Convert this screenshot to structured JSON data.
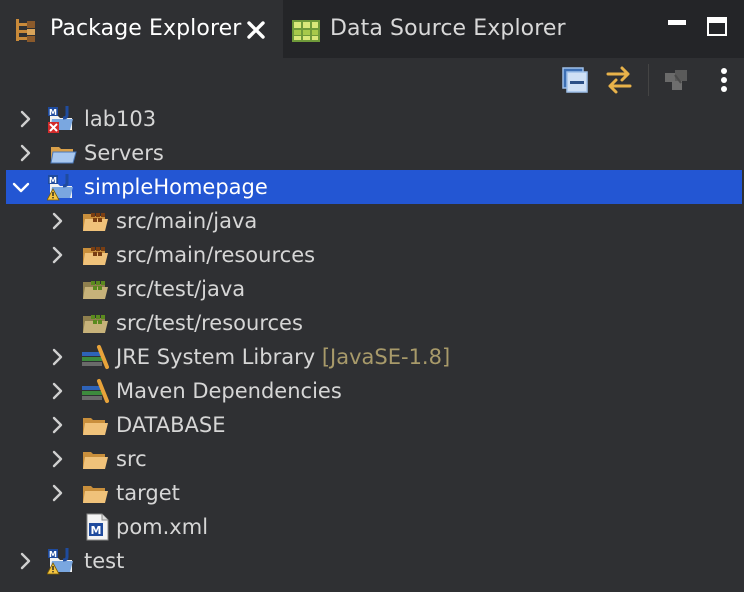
{
  "tabs": [
    {
      "label": "Package Explorer",
      "icon": "package-explorer-icon",
      "active": true
    },
    {
      "label": "Data Source Explorer",
      "icon": "data-source-explorer-icon",
      "active": false
    }
  ],
  "window_controls": {
    "minimize": "minimize-icon",
    "maximize": "maximize-icon"
  },
  "toolbar": {
    "buttons": [
      "collapse-all-icon",
      "link-with-editor-icon",
      "filter-icon",
      "view-menu-icon"
    ]
  },
  "tree": {
    "items": [
      {
        "label": "lab103",
        "depth": 0,
        "expander": "collapsed",
        "icon": "maven-project-error-icon"
      },
      {
        "label": "Servers",
        "depth": 0,
        "expander": "collapsed",
        "icon": "folder-project-icon"
      },
      {
        "label": "simpleHomepage",
        "depth": 0,
        "expander": "expanded",
        "icon": "maven-project-warning-icon",
        "selected": true
      },
      {
        "label": "src/main/java",
        "depth": 1,
        "expander": "collapsed",
        "icon": "source-folder-icon"
      },
      {
        "label": "src/main/resources",
        "depth": 1,
        "expander": "collapsed",
        "icon": "source-folder-icon"
      },
      {
        "label": "src/test/java",
        "depth": 1,
        "expander": "none",
        "icon": "test-source-folder-icon"
      },
      {
        "label": "src/test/resources",
        "depth": 1,
        "expander": "none",
        "icon": "test-source-folder-icon"
      },
      {
        "label": "JRE System Library",
        "decoration": "[JavaSE-1.8]",
        "depth": 1,
        "expander": "collapsed",
        "icon": "library-icon"
      },
      {
        "label": "Maven Dependencies",
        "depth": 1,
        "expander": "collapsed",
        "icon": "library-icon"
      },
      {
        "label": "DATABASE",
        "depth": 1,
        "expander": "collapsed",
        "icon": "folder-icon"
      },
      {
        "label": "src",
        "depth": 1,
        "expander": "collapsed",
        "icon": "folder-icon"
      },
      {
        "label": "target",
        "depth": 1,
        "expander": "collapsed",
        "icon": "folder-icon"
      },
      {
        "label": "pom.xml",
        "depth": 1,
        "expander": "none",
        "icon": "maven-pom-file-icon"
      },
      {
        "label": "test",
        "depth": 0,
        "expander": "collapsed",
        "icon": "maven-project-warning-icon"
      }
    ]
  },
  "colors": {
    "background": "#2f3033",
    "tabbar_background": "#242528",
    "selection": "#2356d3",
    "decoration_text": "#a89a6a",
    "folder": "#e8b75a"
  }
}
